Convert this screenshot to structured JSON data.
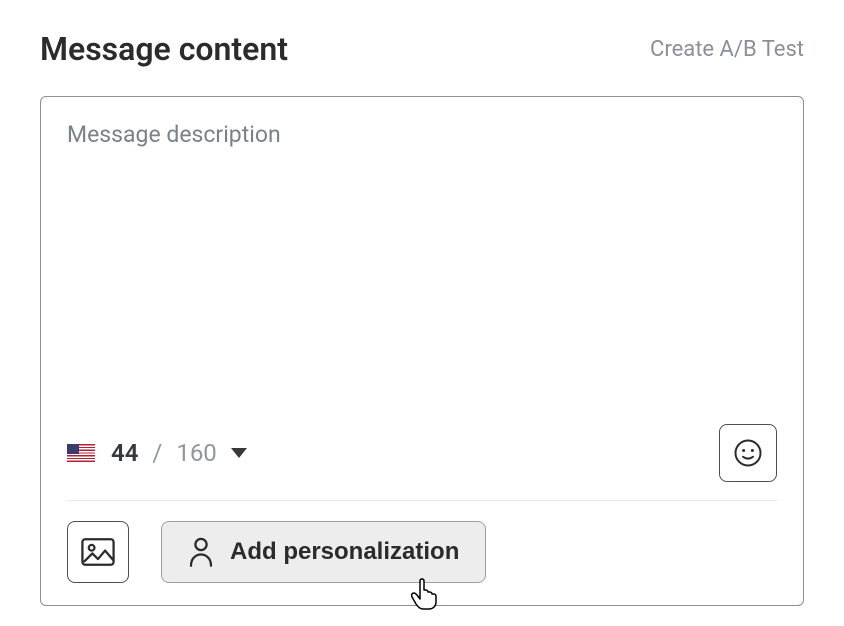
{
  "header": {
    "title": "Message content",
    "ab_test_label": "Create A/B Test"
  },
  "editor": {
    "placeholder": "Message description",
    "value": ""
  },
  "counter": {
    "flag": "us",
    "current": "44",
    "separator": "/",
    "max": "160"
  },
  "buttons": {
    "emoji_icon": "smile-icon",
    "image_icon": "image-icon",
    "personalization_icon": "person-icon",
    "personalization_label": "Add personalization"
  }
}
